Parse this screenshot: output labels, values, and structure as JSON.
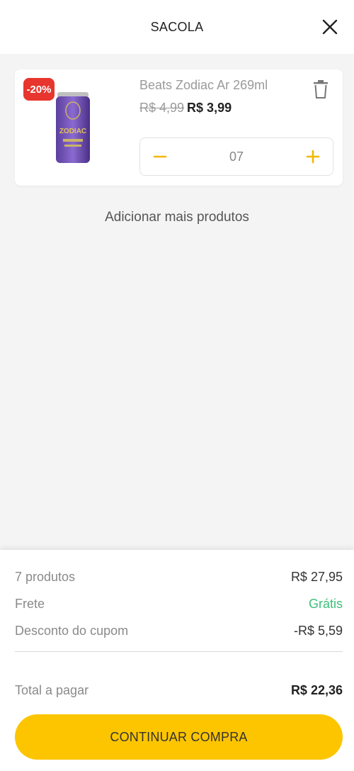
{
  "header": {
    "title": "SACOLA",
    "close_icon": "close-icon"
  },
  "cart": {
    "item": {
      "name": "Beats Zodiac Ar 269ml",
      "discount_badge": "-20%",
      "old_price": "R$ 4,99",
      "new_price": "R$ 3,99",
      "quantity": "07",
      "image_label": "ZODIAC",
      "icons": {
        "delete": "trash-icon",
        "decrease": "minus-icon",
        "increase": "plus-icon"
      }
    },
    "add_more_label": "Adicionar mais produtos"
  },
  "summary": {
    "products_label": "7 produtos",
    "products_value": "R$ 27,95",
    "shipping_label": "Frete",
    "shipping_value": "Grátis",
    "coupon_label": "Desconto do cupom",
    "coupon_value": "-R$ 5,59",
    "total_label": "Total a pagar",
    "total_value": "R$ 22,36",
    "continue_label": "CONTINUAR COMPRA"
  },
  "colors": {
    "accent": "#fdc500",
    "badge": "#e8352e",
    "free": "#3cc07a",
    "background": "#f4f4f4"
  }
}
